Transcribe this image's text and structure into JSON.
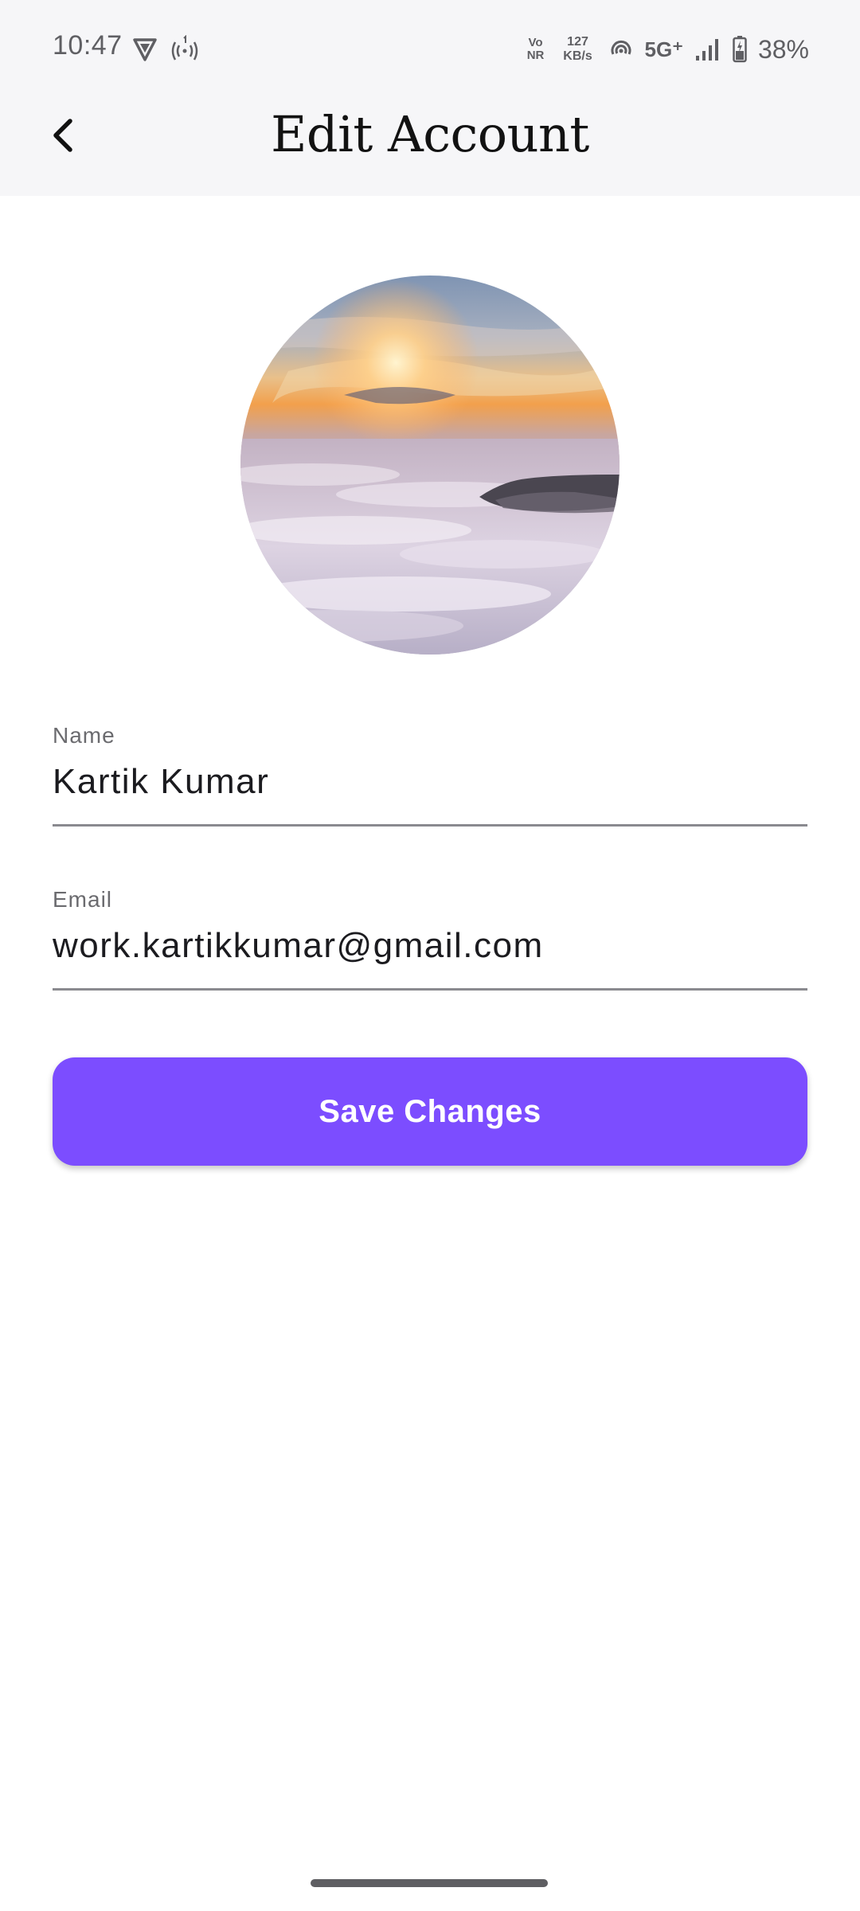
{
  "status_bar": {
    "time": "10:47",
    "left_icons": [
      "vpn-shield-icon",
      "hotspot-icon"
    ],
    "vonr_top": "Vo",
    "vonr_bottom": "NR",
    "speed_value": "127",
    "speed_unit": "KB/s",
    "network_type": "5G⁺",
    "battery_percent": "38%",
    "right_icons": [
      "vonr-icon",
      "network-speed-icon",
      "wifi-calling-icon",
      "signal-icon",
      "battery-icon"
    ]
  },
  "app_bar": {
    "back_icon": "chevron-left-icon",
    "title": "Edit Account"
  },
  "avatar": {
    "icon": "profile-photo"
  },
  "form": {
    "name_label": "Name",
    "name_value": "Kartik Kumar",
    "email_label": "Email",
    "email_value": "work.kartikkumar@gmail.com"
  },
  "actions": {
    "save_label": "Save Changes"
  },
  "colors": {
    "accent": "#7c4dff",
    "header_background": "#f6f6f8",
    "text_primary": "#121212",
    "text_secondary": "#6b6b6f",
    "underline": "#8a8a8f"
  }
}
